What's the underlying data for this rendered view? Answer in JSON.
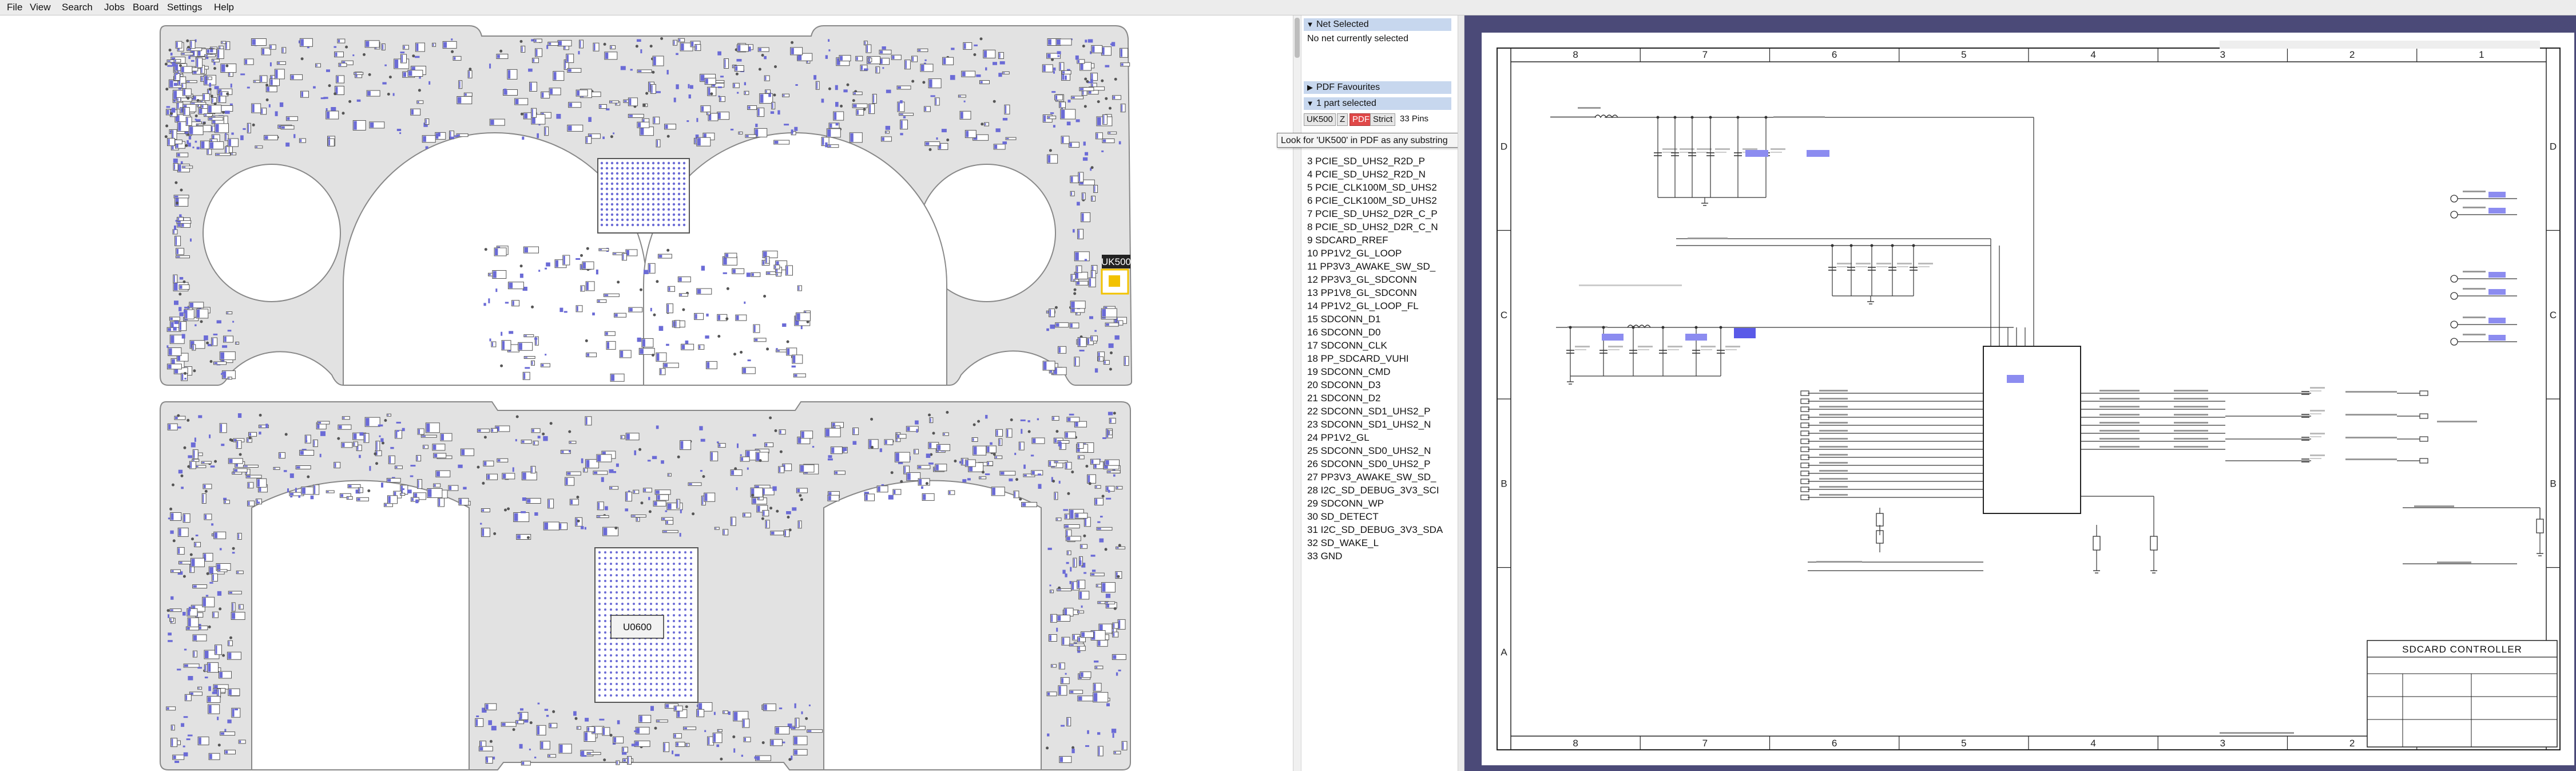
{
  "menubar": {
    "items": [
      "File",
      "View",
      "Search",
      "Jobs",
      "Board",
      "Settings",
      "Help"
    ]
  },
  "board": {
    "highlight_label": "UK500",
    "chip_labels": [
      "U0600"
    ],
    "colors": {
      "board_fill": "#e2e2e2",
      "board_outline": "#888888",
      "component_fill": "#ffffff",
      "component_outline": "#555555",
      "pad_color": "#6b6bd6",
      "highlight": "#f2c200"
    }
  },
  "side_panel": {
    "net_selected": {
      "header": "Net Selected",
      "message": "No net currently selected"
    },
    "pdf_favourites": {
      "header": "PDF Favourites"
    },
    "part_selected": {
      "header": "1 part selected",
      "part_name": "UK500",
      "z_label": "Z",
      "pdf_label": "PDF",
      "strict_label": "Strict",
      "pins_label": "33 Pins"
    },
    "tooltip": "Look for 'UK500' in PDF as any substring",
    "pins": [
      "3  PCIE_SD_UHS2_R2D_P",
      "4  PCIE_SD_UHS2_R2D_N",
      "5  PCIE_CLK100M_SD_UHS2",
      "6  PCIE_CLK100M_SD_UHS2",
      "7  PCIE_SD_UHS2_D2R_C_P",
      "8  PCIE_SD_UHS2_D2R_C_N",
      "9  SDCARD_RREF",
      "10  PP1V2_GL_LOOP",
      "11  PP3V3_AWAKE_SW_SD_",
      "12  PP3V3_GL_SDCONN",
      "13  PP1V8_GL_SDCONN",
      "14  PP1V2_GL_LOOP_FL",
      "15  SDCONN_D1",
      "16  SDCONN_D0",
      "17  SDCONN_CLK",
      "18  PP_SDCARD_VUHI",
      "19  SDCONN_CMD",
      "20  SDCONN_D3",
      "21  SDCONN_D2",
      "22  SDCONN_SD1_UHS2_P",
      "23  SDCONN_SD1_UHS2_N",
      "24  PP1V2_GL",
      "25  SDCONN_SD0_UHS2_N",
      "26  SDCONN_SD0_UHS2_P",
      "27  PP3V3_AWAKE_SW_SD_",
      "28  I2C_SD_DEBUG_3V3_SCI",
      "29  SDCONN_WP",
      "30  SD_DETECT",
      "31  I2C_SD_DEBUG_3V3_SDA",
      "32  SD_WAKE_L",
      "33  GND"
    ]
  },
  "schematic": {
    "column_labels": [
      "8",
      "7",
      "6",
      "5",
      "4",
      "3",
      "2",
      "1"
    ],
    "row_labels": [
      "D",
      "C",
      "B",
      "A"
    ],
    "title_block": "SDCARD CONTROLLER",
    "colors": {
      "background": "#4b4a78",
      "page": "#ffffff",
      "ink": "#222222",
      "highlight": "#8c8cf0"
    }
  }
}
